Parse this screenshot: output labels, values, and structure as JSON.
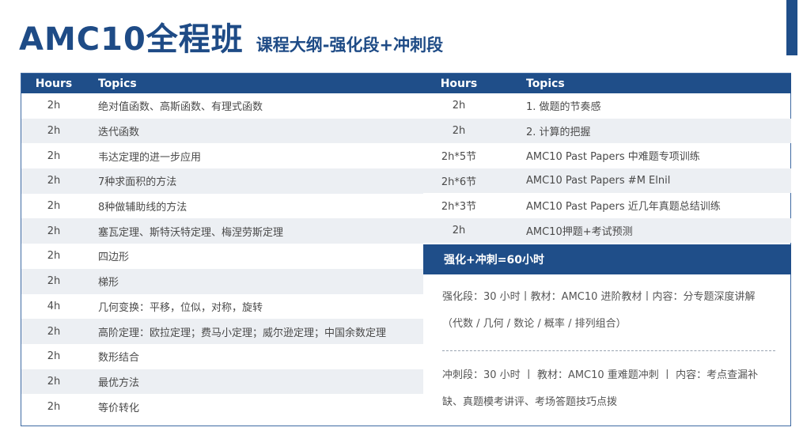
{
  "header": {
    "title": "AMC10全程班",
    "subtitle": "课程大纲-强化段+冲刺段"
  },
  "left_table": {
    "col_hours": "Hours",
    "col_topics": "Topics",
    "rows": [
      {
        "hours": "2h",
        "topic": "绝对值函数、高斯函数、有理式函数"
      },
      {
        "hours": "2h",
        "topic": "迭代函数"
      },
      {
        "hours": "2h",
        "topic": "韦达定理的进一步应用"
      },
      {
        "hours": "2h",
        "topic": "7种求面积的方法"
      },
      {
        "hours": "2h",
        "topic": "8种做辅助线的方法"
      },
      {
        "hours": "2h",
        "topic": "塞瓦定理、斯特沃特定理、梅涅劳斯定理"
      },
      {
        "hours": "2h",
        "topic": "四边形"
      },
      {
        "hours": "2h",
        "topic": "梯形"
      },
      {
        "hours": "4h",
        "topic": "几何变换：平移，位似，对称，旋转"
      },
      {
        "hours": "2h",
        "topic": "高阶定理：欧拉定理；费马小定理；威尔逊定理；中国余数定理"
      },
      {
        "hours": "2h",
        "topic": "数形结合"
      },
      {
        "hours": "2h",
        "topic": "最优方法"
      },
      {
        "hours": "2h",
        "topic": "等价转化"
      }
    ]
  },
  "right_table": {
    "col_hours": "Hours",
    "col_topics": "Topics",
    "rows": [
      {
        "hours": "2h",
        "topic": "1. 做题的节奏感"
      },
      {
        "hours": "2h",
        "topic": "2. 计算的把握"
      },
      {
        "hours": "2h*5节",
        "topic": "AMC10 Past Papers 中难题专项训练"
      },
      {
        "hours": "2h*6节",
        "topic": "AMC10 Past Papers #M Elnil"
      },
      {
        "hours": "2h*3节",
        "topic": "AMC10 Past Papers 近几年真题总结训练"
      },
      {
        "hours": "2h",
        "topic": "AMC10押题+考试预测"
      }
    ]
  },
  "summary": {
    "title": "强化+冲刺=60小时",
    "line1": "强化段：30 小时丨教材：AMC10 进阶教材丨内容：分专题深度讲解",
    "line2": "（代数 / 几何 / 数论 / 概率 / 排列组合）",
    "line3": "冲刺段：30  小时  丨 教材：AMC10  重难题冲刺  丨 内容：考点查漏补",
    "line4": "缺、真题模考讲评、考场答题技巧点拨"
  },
  "colors": {
    "primary": "#1f4e89",
    "row_alt": "#eceff3",
    "text": "#4a4a4a"
  }
}
